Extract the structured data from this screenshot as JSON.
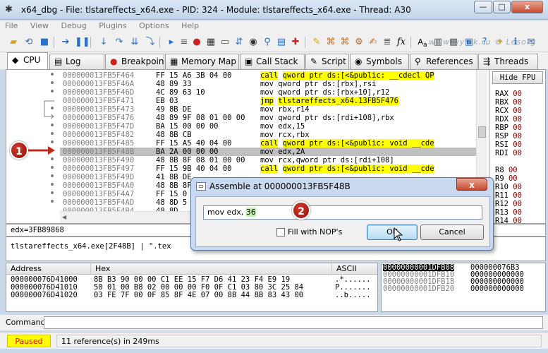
{
  "window": {
    "title": "x64_dbg - File: tlstareffects_x64.exe - PID: 324 - Module: tlstareffects_x64.exe - Thread: A30",
    "minimize": "—",
    "maximize": "□",
    "close": "x"
  },
  "menu": [
    "File",
    "View",
    "Debug",
    "Plugins",
    "Options",
    "Help"
  ],
  "watermark": "www.wylek.ru © Lesorg",
  "toolbar": {
    "icons": [
      "open-icon",
      "restart-icon",
      "stop-icon",
      "run-icon",
      "pause-icon",
      "step-into-icon",
      "step-over-icon",
      "run-to-user-icon",
      "execute-till-return-icon",
      "breakpoint-icon",
      "run-selection-icon",
      "memory-map-icon",
      "call-stack-icon",
      "script-icon",
      "symbols-icon",
      "references-icon",
      "threads-icon",
      "patch-icon",
      "comments-icon",
      "labels-icon",
      "bookmarks-icon",
      "functions-icon",
      "strings-icon",
      "font-icon",
      "settings-icon",
      "calculator-icon",
      "help-icon",
      "info-icon"
    ],
    "fx": "fx",
    "aa": "A",
    "aa_sub": "a"
  },
  "tabs": [
    {
      "label": "CPU",
      "icon": "◆",
      "active": true
    },
    {
      "label": "Log",
      "icon": "▤"
    },
    {
      "label": "Breakpoints",
      "icon": "●"
    },
    {
      "label": "Memory Map",
      "icon": "▦"
    },
    {
      "label": "Call Stack",
      "icon": "▣"
    },
    {
      "label": "Script",
      "icon": "✎"
    },
    {
      "label": "Symbols",
      "icon": "◉"
    },
    {
      "label": "References",
      "icon": "⚲"
    },
    {
      "label": "Threads",
      "icon": "⇶"
    }
  ],
  "disasm": [
    {
      "addr": "000000013FB5F464",
      "bytes": "FF 15 A6 3B 04 00",
      "op": "call",
      "args": "qword ptr ds:[<&public: __cdecl QP",
      "hl": true
    },
    {
      "addr": "000000013FB5F46A",
      "bytes": "48 89 33",
      "op": "mov",
      "args": "qword ptr ds:[rbx],rsi"
    },
    {
      "addr": "000000013FB5F46D",
      "bytes": "4C 89 63 10",
      "op": "mov",
      "args": "qword ptr ds:[rbx+10],r12"
    },
    {
      "addr": "000000013FB5F471",
      "bytes": "EB 03",
      "op": "jmp",
      "args": "tlstareffects_x64.13FB5F476",
      "hl": true
    },
    {
      "addr": "000000013FB5F473",
      "bytes": "49 8B DE",
      "op": "mov",
      "args": "rbx,r14"
    },
    {
      "addr": "000000013FB5F476",
      "bytes": "48 89 9F 08 01 00 00",
      "op": "mov",
      "args": "qword ptr ds:[rdi+108],rbx"
    },
    {
      "addr": "000000013FB5F47D",
      "bytes": "BA 15 00 00 00",
      "op": "mov",
      "args": "edx,15"
    },
    {
      "addr": "000000013FB5F482",
      "bytes": "48 8B CB",
      "op": "mov",
      "args": "rcx,rbx"
    },
    {
      "addr": "000000013FB5F485",
      "bytes": "FF 15 A5 40 04 00",
      "op": "call",
      "args": "qword ptr ds:[<&public: void __cde",
      "hl": true
    },
    {
      "addr": "000000013FB5F48B",
      "bytes": "BA 2A 00 00 00",
      "op": "mov",
      "args": "edx,2A",
      "sel": true
    },
    {
      "addr": "000000013FB5F490",
      "bytes": "48 8B 8F 08 01 00 00",
      "op": "mov",
      "args": "rcx,qword ptr ds:[rdi+108]"
    },
    {
      "addr": "000000013FB5F497",
      "bytes": "FF 15 9B 40 04 00",
      "op": "call",
      "args": "qword ptr ds:[<&public: void __cde",
      "hl": true
    },
    {
      "addr": "000000013FB5F49D",
      "bytes": "41 8B DE",
      "op": "",
      "args": ""
    },
    {
      "addr": "000000013FB5F4A0",
      "bytes": "48 8B 8F 08",
      "op": "",
      "args": ""
    },
    {
      "addr": "000000013FB5F4A7",
      "bytes": "FF 15 0",
      "op": "",
      "args": ""
    },
    {
      "addr": "000000013FB5F4AD",
      "bytes": "48 8D 5",
      "op": "",
      "args": ""
    },
    {
      "addr": "000000013FB5F4B4",
      "bytes": "48 8D",
      "op": "",
      "args": ""
    }
  ],
  "registers": {
    "hide_fpu": "Hide FPU",
    "items": [
      {
        "name": "RAX",
        "val": "00"
      },
      {
        "name": "RBX",
        "val": "00"
      },
      {
        "name": "RCX",
        "val": "00"
      },
      {
        "name": "RDX",
        "val": "00"
      },
      {
        "name": "RBP",
        "val": "00"
      },
      {
        "name": "RSP",
        "val": "00"
      },
      {
        "name": "RSI",
        "val": "00"
      },
      {
        "name": "RDI",
        "val": "00"
      },
      {
        "name": "R8",
        "val": "00"
      },
      {
        "name": "R9",
        "val": "00"
      },
      {
        "name": "R10",
        "val": "00"
      },
      {
        "name": "R11",
        "val": "00"
      },
      {
        "name": "R12",
        "val": "00"
      },
      {
        "name": "R13",
        "val": "00"
      },
      {
        "name": "R14",
        "val": "00"
      },
      {
        "name": "R15",
        "val": "00"
      },
      {
        "name": "RIP",
        "val": "00"
      }
    ]
  },
  "info_line": "edx=3FB89868",
  "info_line2": "tlstareffects_x64.exe[2F48B] | \".tex",
  "dump": {
    "headers": [
      "Address",
      "Hex",
      "ASCII"
    ],
    "rows": [
      {
        "addr": "000000076D41000",
        "hex": "8B B3 90 00 00 C1 EE 15 F7 D6 41 23 F4 E9 19",
        "ascii": ".*......"
      },
      {
        "addr": "000000076D41010",
        "hex": "50 01 00 B8 02 00 00 00 F0 0F C1 03 80 3C 25 84",
        "ascii": "P......."
      },
      {
        "addr": "000000076D41020",
        "hex": "03 FE 7F 00 0F 85 8F 4E 07 00 8B 44 8B 83 43 00",
        "ascii": "..b....."
      }
    ]
  },
  "stack": {
    "rows": [
      {
        "addr": "00000000001DFB08",
        "val": "000000076B3",
        "sel": true
      },
      {
        "addr": "00000000001DFB10",
        "val": "000000000000"
      },
      {
        "addr": "00000000001DFB18",
        "val": "000000000000"
      },
      {
        "addr": "00000000001DFB20",
        "val": "000000000000"
      }
    ]
  },
  "command": {
    "label": "Command:",
    "value": ""
  },
  "status": {
    "state": "Paused",
    "message": "11 reference(s) in 249ms"
  },
  "dialog": {
    "title": "Assemble at 000000013FB5F48B",
    "close": "x",
    "input_prefix": "mov edx, ",
    "input_num": "36",
    "checkbox_label": "Fill with NOP's",
    "ok": "OK",
    "cancel": "Cancel"
  },
  "callouts": [
    "1",
    "2"
  ],
  "colors": {
    "highlight": "#ffff00",
    "paused_text": "#f00000",
    "callout": "#b01e14",
    "selected_row": "#c0c0c0"
  }
}
